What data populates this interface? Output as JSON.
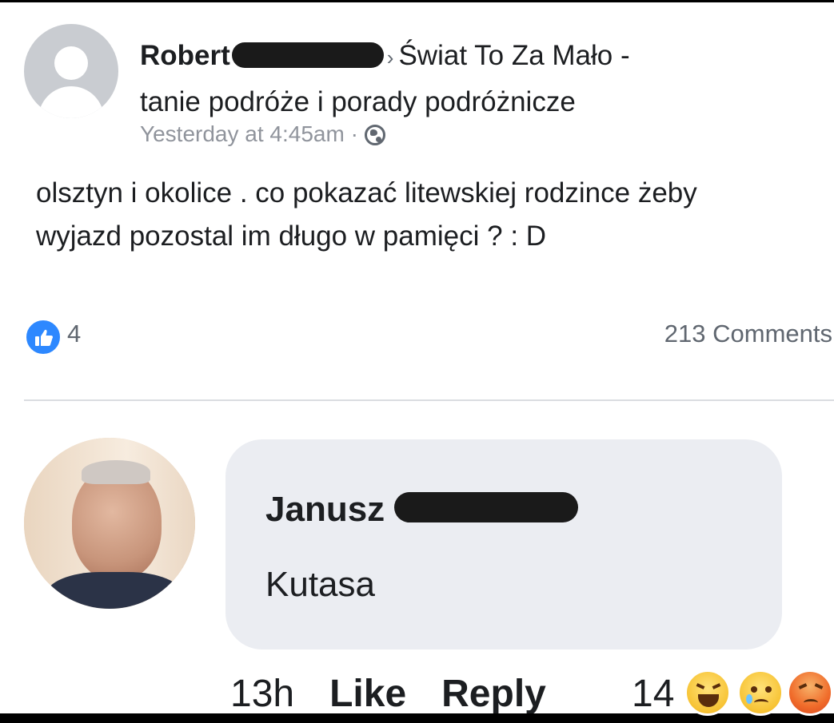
{
  "post": {
    "author": "Robert",
    "separator": "›",
    "group_line1": "Świat To Za Mało -",
    "group_line2": "tanie podróże i porady podróżnicze",
    "timestamp": "Yesterday at 4:45am ·",
    "privacy_icon": "globe-icon",
    "text_line1": "olsztyn i okolice . co pokazać litewskiej rodzince żeby",
    "text_line2": "wyjazd pozostal im długo w pamięci ? : D"
  },
  "reactions_bar": {
    "like_icon": "thumbs-up-icon",
    "like_count": "4",
    "comments_count": "213 Comments"
  },
  "comment": {
    "author": "Janusz",
    "text": "Kutasa",
    "time": "13h",
    "like_label": "Like",
    "reply_label": "Reply",
    "reaction_count": "14",
    "reaction_icons": [
      "haha-icon",
      "sad-icon",
      "angry-icon"
    ]
  },
  "colors": {
    "like_blue": "#2d88ff",
    "bubble_bg": "#ebedf2",
    "meta_gray": "#90949c"
  }
}
